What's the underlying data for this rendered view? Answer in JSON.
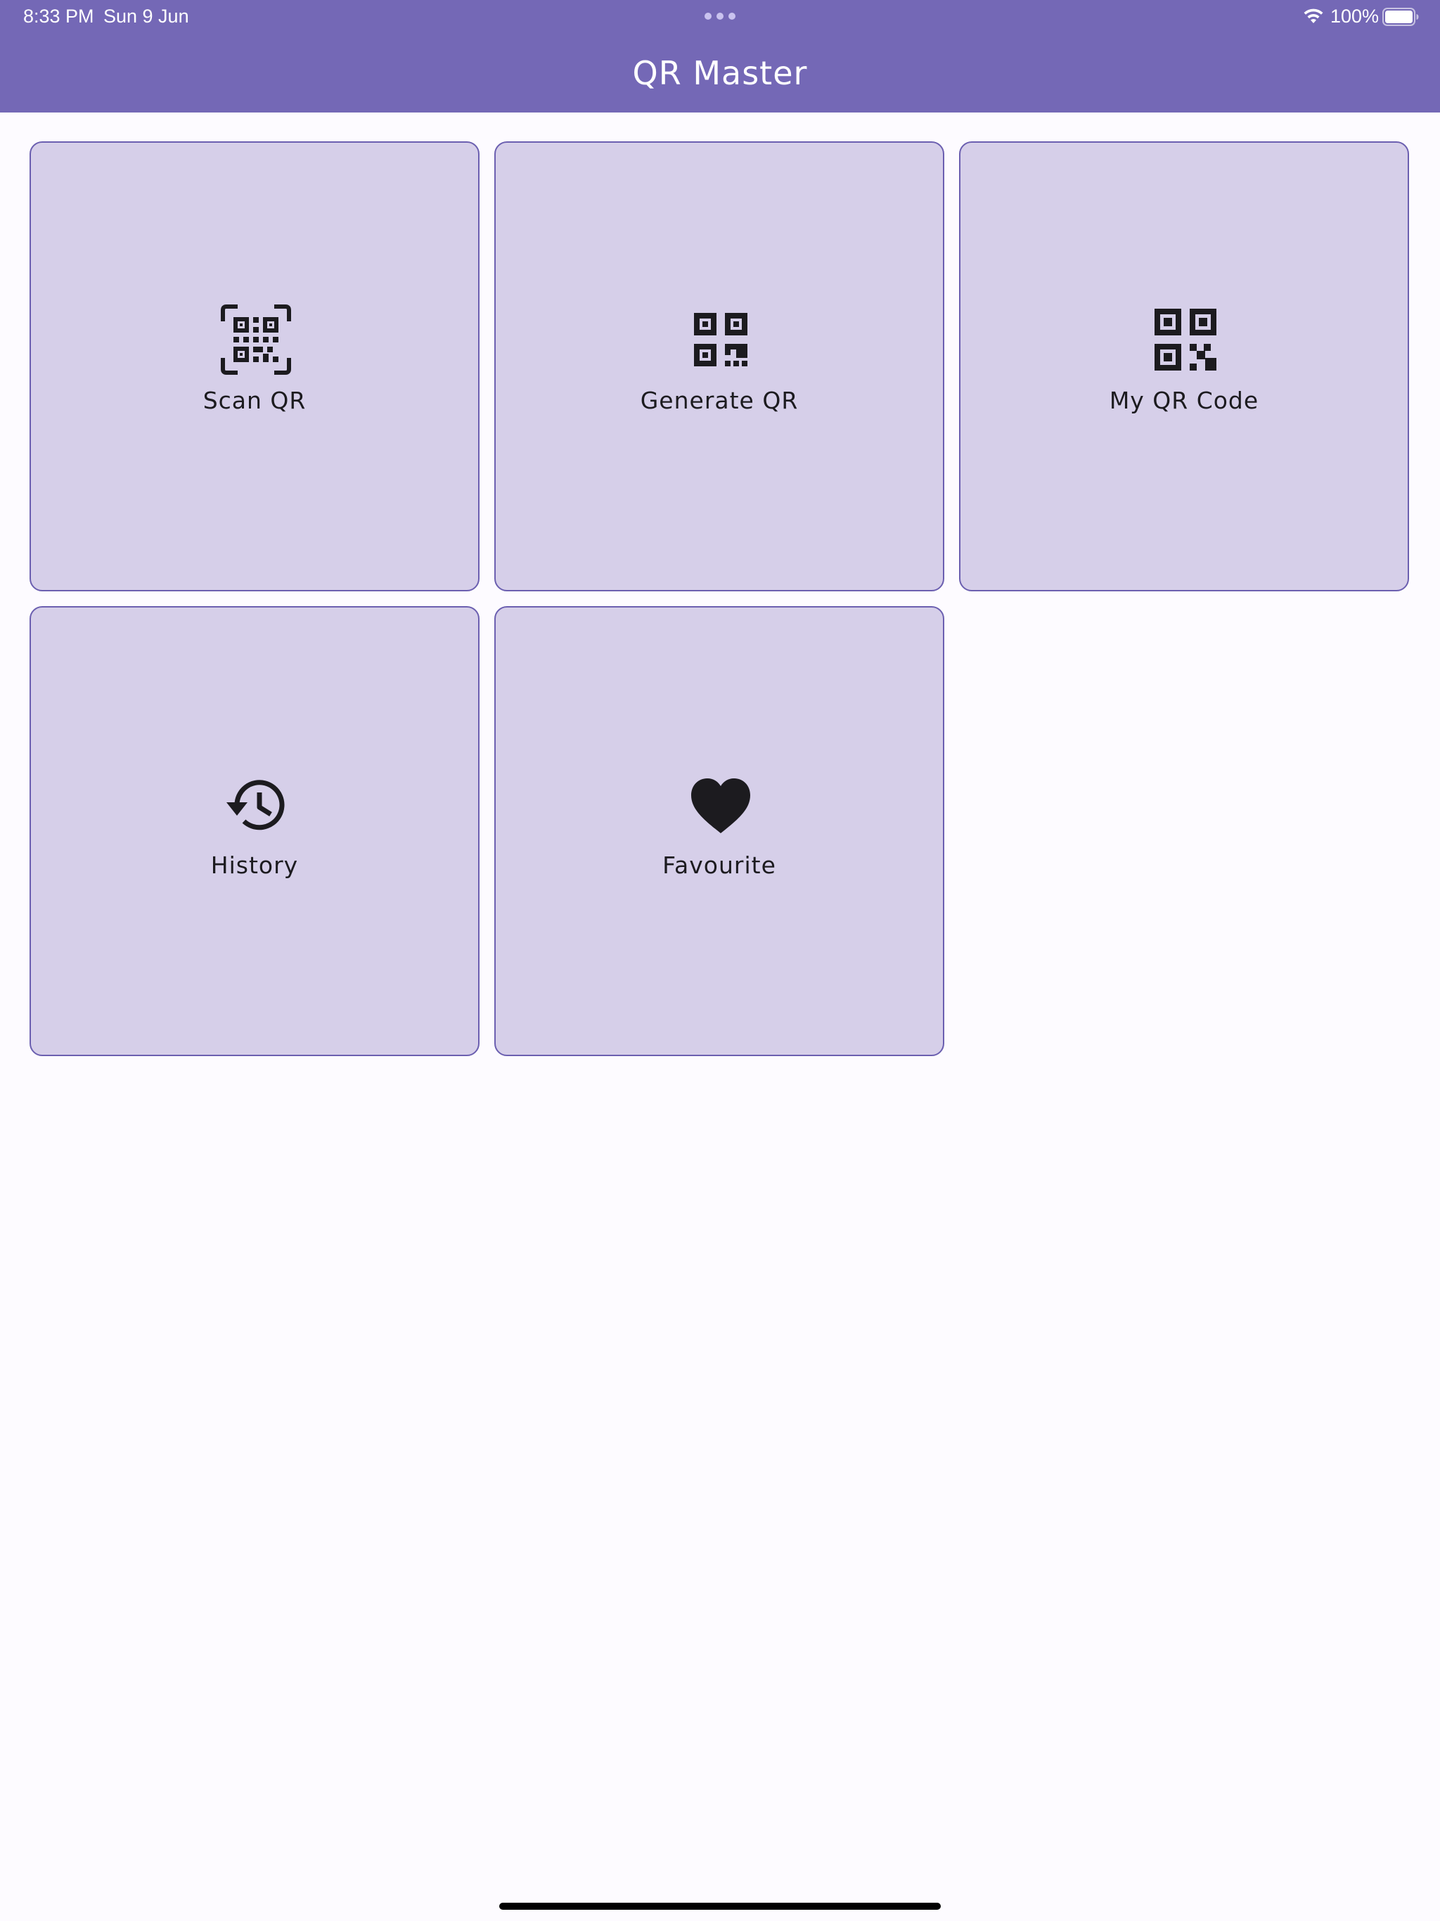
{
  "status_bar": {
    "time": "8:33 PM",
    "date": "Sun 9 Jun",
    "battery_percent": "100%",
    "battery_level": 1.0,
    "icons": [
      "wifi-icon",
      "battery-icon"
    ]
  },
  "app": {
    "title": "QR Master"
  },
  "tiles": [
    {
      "label": "Scan QR",
      "icon": "qr-scanner-icon"
    },
    {
      "label": "Generate QR",
      "icon": "qr-code-icon"
    },
    {
      "label": "My QR Code",
      "icon": "qr-code-2-icon"
    },
    {
      "label": "History",
      "icon": "history-icon"
    },
    {
      "label": "Favourite",
      "icon": "heart-icon"
    }
  ],
  "colors": {
    "app_bar": "#7468b6",
    "tile_background": "#d6cfe9",
    "tile_border": "#6b5fb0",
    "page_background": "#fdfbff",
    "icon": "#1c1b1f"
  }
}
